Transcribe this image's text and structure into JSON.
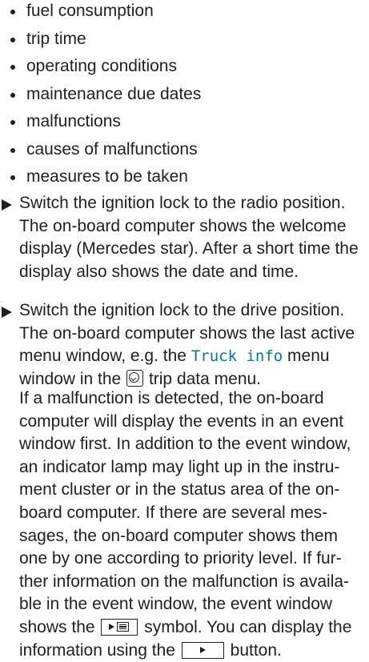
{
  "bullets": [
    "fuel consumption",
    "trip time",
    "operating conditions",
    "maintenance due dates",
    "malfunctions",
    "causes of malfunctions",
    "measures to be taken"
  ],
  "step1": {
    "l1": "Switch the ignition lock to the radio position.",
    "l2": "The on-board computer shows the welcome",
    "l3": "display (Mercedes star). After a short time the",
    "l4": "display also shows the date and time."
  },
  "step2": {
    "l1": "Switch the ignition lock to the drive position.",
    "l2": "The on-board computer shows the last active",
    "l3a": "menu window, e.g. the",
    "l3_mono": "Truck info",
    "l3b": "menu",
    "l4a": "window in the",
    "l4b": "trip data menu.",
    "trip_icon": "trip-data-icon"
  },
  "info": {
    "l1": "If a malfunction is detected, the on-board",
    "l2": "computer will display the events in an event",
    "l3": "window first. In addition to the event window,",
    "l4": "an indicator lamp may light up in the instru-",
    "l5": "ment cluster or in the status area of the on-",
    "l6": "board computer. If there are several mes-",
    "l7": "sages, the on-board computer shows them",
    "l8": "one by one according to priority level. If fur-",
    "l9": "ther information on the malfunction is availa-",
    "l10": "ble in the event window, the event window",
    "l11a": "shows the",
    "l11b": "symbol. You can display the",
    "l12a": "information using the",
    "l12b": "button.",
    "list_symbol_icon": "play-list-icon",
    "next_button_icon": "play-button-icon"
  }
}
